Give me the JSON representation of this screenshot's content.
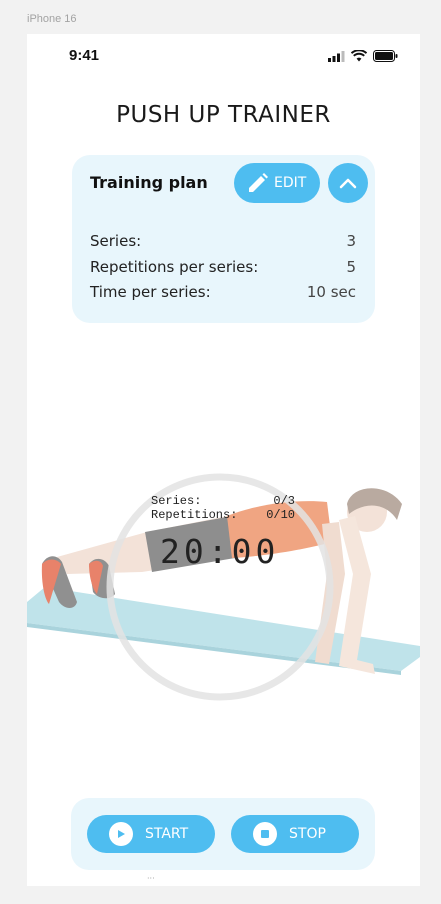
{
  "frame": {
    "label": "iPhone 16"
  },
  "status": {
    "time": "9:41"
  },
  "app": {
    "title": "PUSH UP TRAINER"
  },
  "plan": {
    "title": "Training plan",
    "edit_label": "EDIT",
    "rows": [
      {
        "label": "Series:",
        "value": "3"
      },
      {
        "label": "Repetitions per series:",
        "value": "5"
      },
      {
        "label": "Time per series:",
        "value": "10 sec"
      }
    ]
  },
  "counter": {
    "series_label": "Series:",
    "series_value": "0/3",
    "reps_label": "Repetitions:",
    "reps_value": "0/10",
    "timer": "20:00"
  },
  "controls": {
    "start_label": "START",
    "stop_label": "STOP"
  },
  "colors": {
    "accent": "#4ebdf0",
    "card_bg": "#e8f6fc"
  }
}
